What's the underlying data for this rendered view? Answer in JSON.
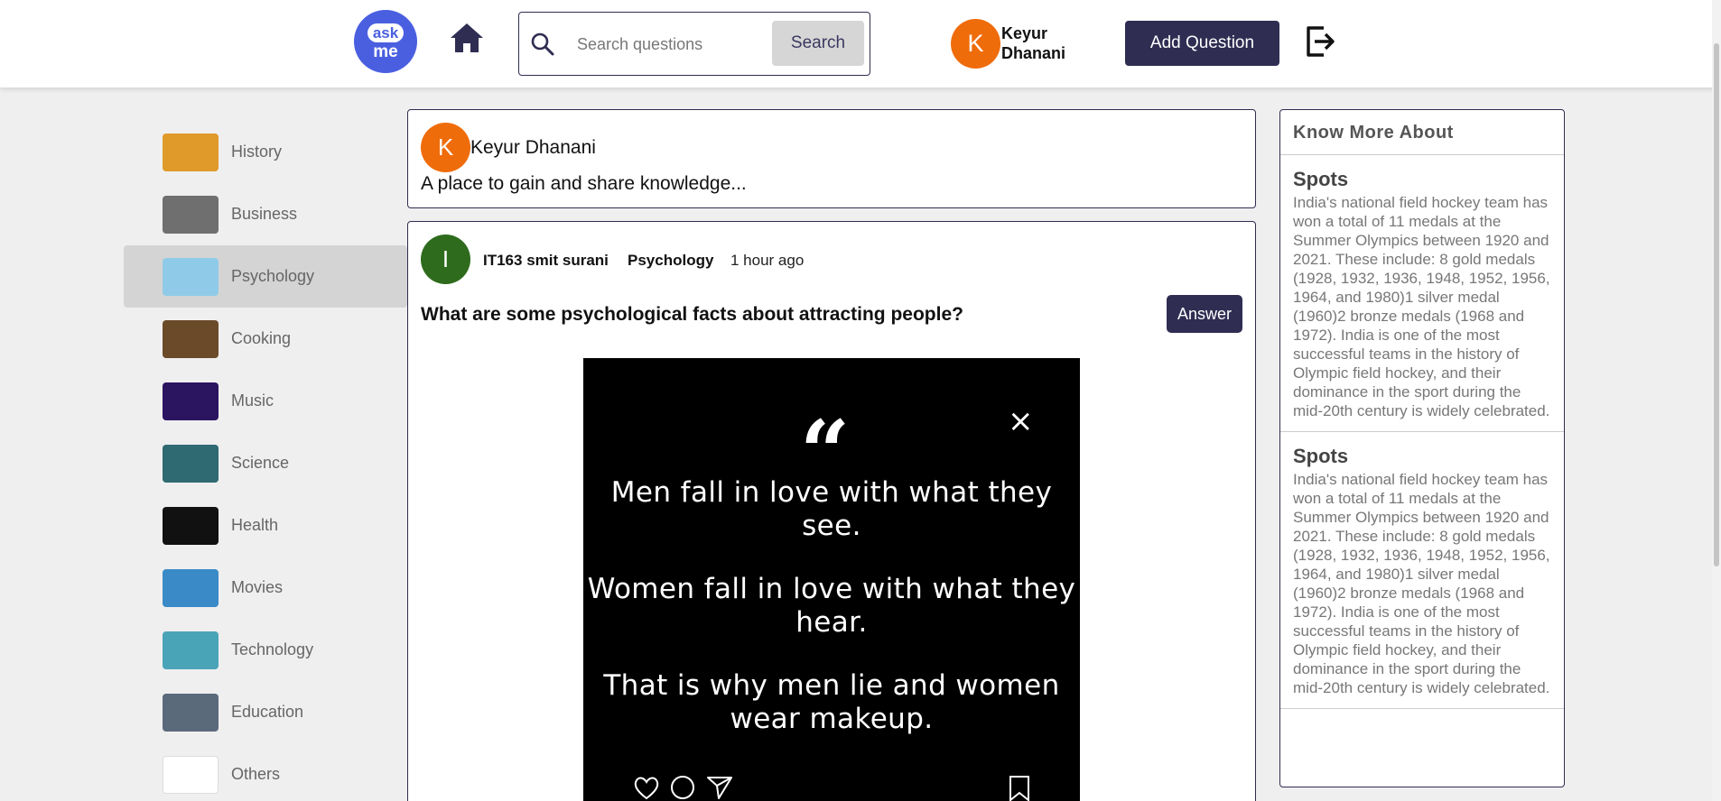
{
  "header": {
    "logo_top": "ask",
    "logo_bottom": "me",
    "search_placeholder": "Search questions",
    "search_button": "Search",
    "user_initial": "K",
    "user_name": "Keyur Dhanani",
    "add_question": "Add Question",
    "icons": [
      "home-icon",
      "search-icon",
      "logout-icon"
    ],
    "colors": {
      "brand": "#2f2d52",
      "logo": "#4a5fe0",
      "avatar": "#ef6c0b"
    }
  },
  "sidebar": {
    "active": "Psychology",
    "items": [
      {
        "label": "History",
        "color": "#e09a2a"
      },
      {
        "label": "Business",
        "color": "#6f6f6f"
      },
      {
        "label": "Psychology",
        "color": "#8fcbe8"
      },
      {
        "label": "Cooking",
        "color": "#6b4a2a"
      },
      {
        "label": "Music",
        "color": "#2b1460"
      },
      {
        "label": "Science",
        "color": "#2f6a72"
      },
      {
        "label": "Health",
        "color": "#111111"
      },
      {
        "label": "Movies",
        "color": "#3a8ac8"
      },
      {
        "label": "Technology",
        "color": "#4aa4b8"
      },
      {
        "label": "Education",
        "color": "#5b6a7b"
      },
      {
        "label": "Others",
        "color": "#ffffff"
      }
    ]
  },
  "composer": {
    "initial": "K",
    "name": "Keyur Dhanani",
    "tagline": "A place to gain and share knowledge..."
  },
  "post": {
    "initial": "I",
    "author": "IT163 smit surani",
    "category": "Psychology",
    "time": "1 hour ago",
    "question": "What are some psychological facts about attracting people?",
    "answer_button": "Answer",
    "image": {
      "quote_mark": "“",
      "close": "×",
      "line1": "Men fall in love with what they see.",
      "line2": "Women fall in love with what they hear.",
      "line3": "That is why men lie and women wear makeup."
    }
  },
  "right_panel": {
    "title": "Know More About",
    "facts": [
      {
        "title": "Spots",
        "text": "India's national field hockey team has won a total of 11 medals at the Summer Olympics between 1920 and 2021. These include: 8 gold medals (1928, 1932, 1936, 1948, 1952, 1956, 1964, and 1980)1 silver medal (1960)2 bronze medals (1968 and 1972). India is one of the most successful teams in the history of Olympic field hockey, and their dominance in the sport during the mid-20th century is widely celebrated."
      },
      {
        "title": "Spots",
        "text": "India's national field hockey team has won a total of 11 medals at the Summer Olympics between 1920 and 2021. These include: 8 gold medals (1928, 1932, 1936, 1948, 1952, 1956, 1964, and 1980)1 silver medal (1960)2 bronze medals (1968 and 1972). India is one of the most successful teams in the history of Olympic field hockey, and their dominance in the sport during the mid-20th century is widely celebrated."
      }
    ]
  }
}
